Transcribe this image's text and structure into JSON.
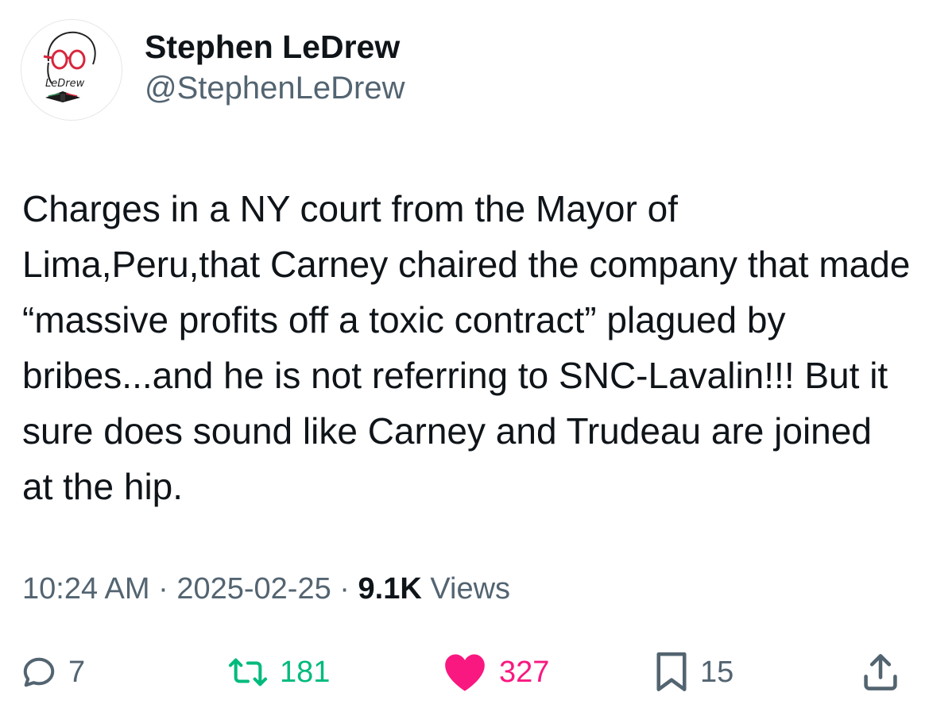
{
  "author": {
    "display_name": "Stephen LeDrew",
    "handle": "@StephenLeDrew",
    "avatar_text": "LeDrew"
  },
  "tweet": {
    "text": "Charges in a NY court from the Mayor of Lima,Peru,that Carney chaired the company that made “massive profits off a toxic contract” plagued by bribes...and he is not referring to SNC-Lavalin!!! But it sure does sound like Carney and Trudeau are joined at the hip."
  },
  "meta": {
    "time": "10:24 AM",
    "separator": " · ",
    "date": "2025-02-25",
    "views_count": "9.1K",
    "views_label": " Views"
  },
  "actions": {
    "replies": "7",
    "retweets": "181",
    "likes": "327",
    "bookmarks": "15"
  },
  "colors": {
    "text": "#0f1419",
    "secondary": "#536471",
    "retweet": "#00ba7c",
    "like": "#f91880"
  },
  "icons": [
    "reply-icon",
    "retweet-icon",
    "heart-icon",
    "bookmark-icon",
    "share-icon"
  ]
}
